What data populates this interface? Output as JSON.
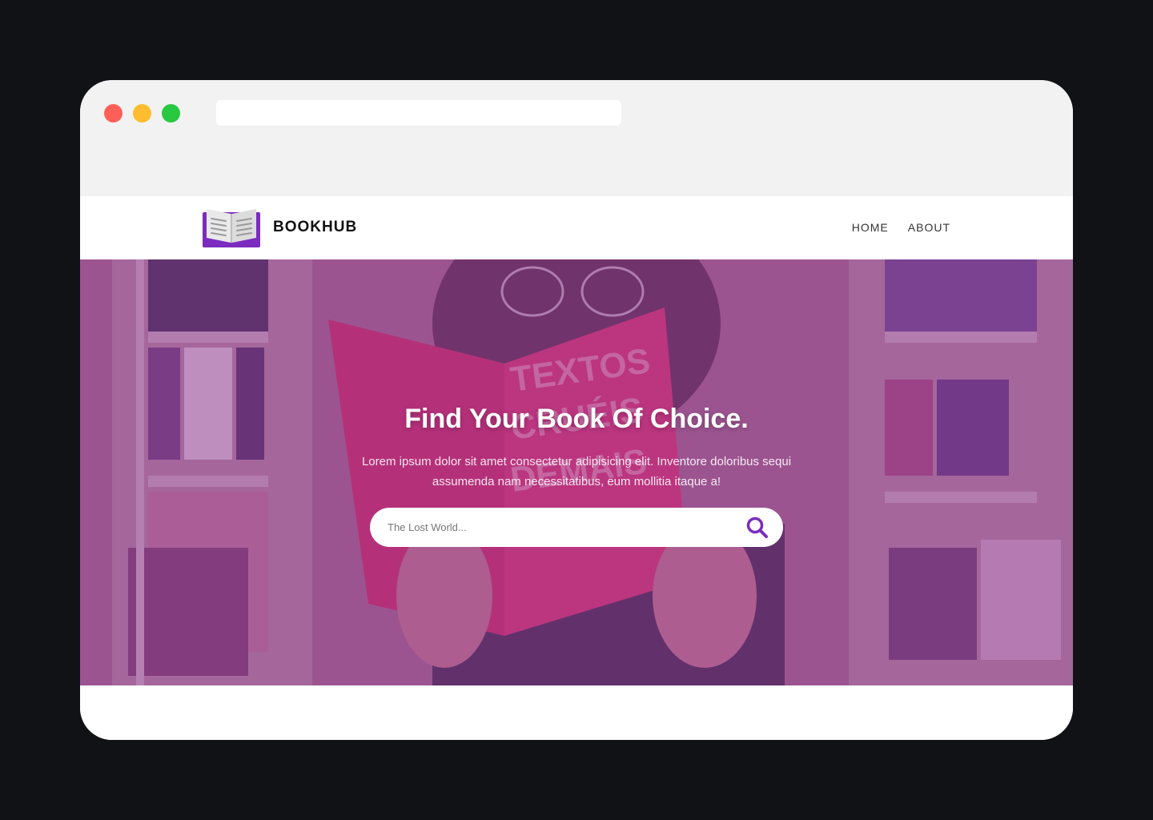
{
  "colors": {
    "accent": "#7b2cbf",
    "window_bg": "#ffffff",
    "chrome_bg": "#f2f2f2",
    "traffic_red": "#ff5f57",
    "traffic_yellow": "#febc2e",
    "traffic_green": "#28c840",
    "hero_overlay": "#8e3a96"
  },
  "navbar": {
    "brand": "BOOKHUB",
    "logo_icon": "open-book-icon",
    "links": [
      {
        "label": "HOME"
      },
      {
        "label": "ABOUT"
      }
    ]
  },
  "hero": {
    "title": "Find Your Book Of Choice.",
    "subtitle": "Lorem ipsum dolor sit amet consectetur adipisicing elit. Inventore doloribus sequi assumenda nam necessitatibus, eum mollitia itaque a!",
    "background_image": "woman-reading-red-book-photo",
    "book_cover_text": "TEXTOS CRUÉIS DEMAIS PARA SEREM LIDOS RAPIDAMENTE"
  },
  "search": {
    "placeholder": "The Lost World...",
    "icon": "search-icon"
  }
}
